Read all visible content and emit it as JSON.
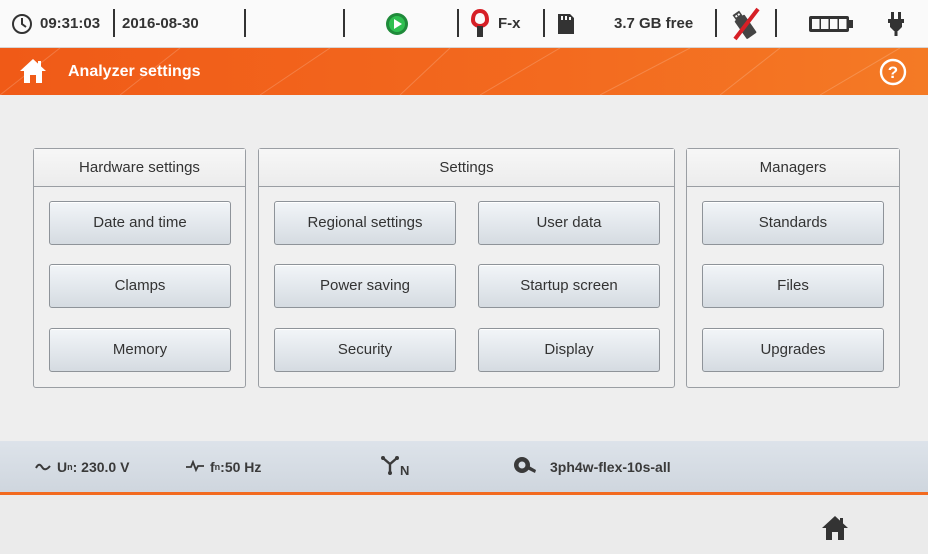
{
  "status_bar": {
    "time": "09:31:03",
    "date": "2016-08-30",
    "clamp_type": "F-x",
    "storage": "3.7 GB free",
    "icons": [
      "clock-icon",
      "record-icon",
      "clamp-icon",
      "sd-card-icon",
      "usb-disconnected-icon",
      "battery-icon",
      "power-plug-icon"
    ]
  },
  "header": {
    "title": "Analyzer settings",
    "home_icon": "home-icon",
    "help_icon": "help-icon",
    "accent": "#f26a1f"
  },
  "groups": {
    "hardware": {
      "title": "Hardware settings",
      "buttons": [
        "Date and time",
        "Clamps",
        "Memory"
      ]
    },
    "settings": {
      "title": "Settings",
      "buttons": [
        "Regional settings",
        "User data",
        "Power saving",
        "Startup screen",
        "Security",
        "Display"
      ]
    },
    "managers": {
      "title": "Managers",
      "buttons": [
        "Standards",
        "Files",
        "Upgrades"
      ]
    }
  },
  "info_bar": {
    "voltage_label": "U",
    "voltage_sub": "n",
    "voltage_value": ": 230.0 V",
    "freq_label": "f",
    "freq_sub": "n",
    "freq_value": ":50 Hz",
    "network_icon_label": "N",
    "config_name": "3ph4w-flex-10s-all"
  },
  "bottom_bar": {
    "home_icon": "home-icon"
  }
}
